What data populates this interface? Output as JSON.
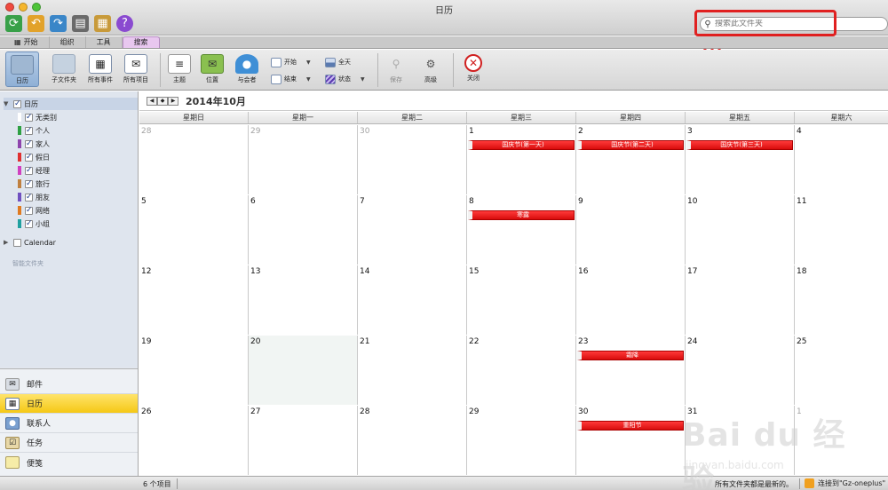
{
  "window": {
    "title": "日历",
    "search": {
      "placeholder": "搜索此文件夹",
      "value": ""
    }
  },
  "tabs": [
    {
      "label": "开始",
      "active": false
    },
    {
      "label": "组织",
      "active": false
    },
    {
      "label": "工具",
      "active": false
    },
    {
      "label": "搜索",
      "active": true
    }
  ],
  "ribbon": {
    "calendar": "日历",
    "subfolders": "子文件夹",
    "all_events": "所有事件",
    "all_items": "所有项目",
    "subject": "主题",
    "location": "位置",
    "attendees": "与会者",
    "start": "开始",
    "end": "结束",
    "all_day": "全天",
    "status": "状态",
    "save": "保存",
    "advanced": "高级",
    "close": "关闭"
  },
  "folders": {
    "root": "日历",
    "categories": [
      {
        "label": "无类别",
        "color": "#ffffff"
      },
      {
        "label": "个人",
        "color": "#2ea043"
      },
      {
        "label": "家人",
        "color": "#8e44ad"
      },
      {
        "label": "假日",
        "color": "#e03030"
      },
      {
        "label": "经理",
        "color": "#d040c0"
      },
      {
        "label": "旅行",
        "color": "#c08040"
      },
      {
        "label": "朋友",
        "color": "#7050c0"
      },
      {
        "label": "网络",
        "color": "#e07a20"
      },
      {
        "label": "小组",
        "color": "#20a0a0"
      }
    ],
    "calendar": "Calendar",
    "smart_folders": "智能文件夹"
  },
  "nav": [
    "邮件",
    "日历",
    "联系人",
    "任务",
    "便笺"
  ],
  "calendar": {
    "month_title": "2014年10月",
    "weekdays": [
      "星期日",
      "星期一",
      "星期二",
      "星期三",
      "星期四",
      "星期五",
      "星期六"
    ],
    "weeks": [
      [
        "28",
        "29",
        "30",
        "1",
        "2",
        "3",
        "4"
      ],
      [
        "5",
        "6",
        "7",
        "8",
        "9",
        "10",
        "11"
      ],
      [
        "12",
        "13",
        "14",
        "15",
        "16",
        "17",
        "18"
      ],
      [
        "19",
        "20",
        "21",
        "22",
        "23",
        "24",
        "25"
      ],
      [
        "26",
        "27",
        "28",
        "29",
        "30",
        "31",
        "1"
      ]
    ],
    "events": {
      "national_day_1": "国庆节(第一天)",
      "national_day_2": "国庆节(第二天)",
      "national_day_3": "国庆节(第三天)",
      "cold_dew": "寒露",
      "frost_descent": "霜降",
      "double_ninth": "重阳节"
    }
  },
  "status": {
    "items_count": "6 个项目",
    "all_up_to_date": "所有文件夹都是最新的。",
    "connected": "连接到\"Gz-oneplus\""
  },
  "watermark": {
    "main": "Bai du 经验",
    "sub": "jingyan.baidu.com"
  },
  "colors": {
    "accent_blue": "#3b7fd1",
    "event_red": "#e01515",
    "nav_selected": "#f7cd1d",
    "tab_active": "#e8c7ef",
    "annotation_red": "#e02020"
  }
}
